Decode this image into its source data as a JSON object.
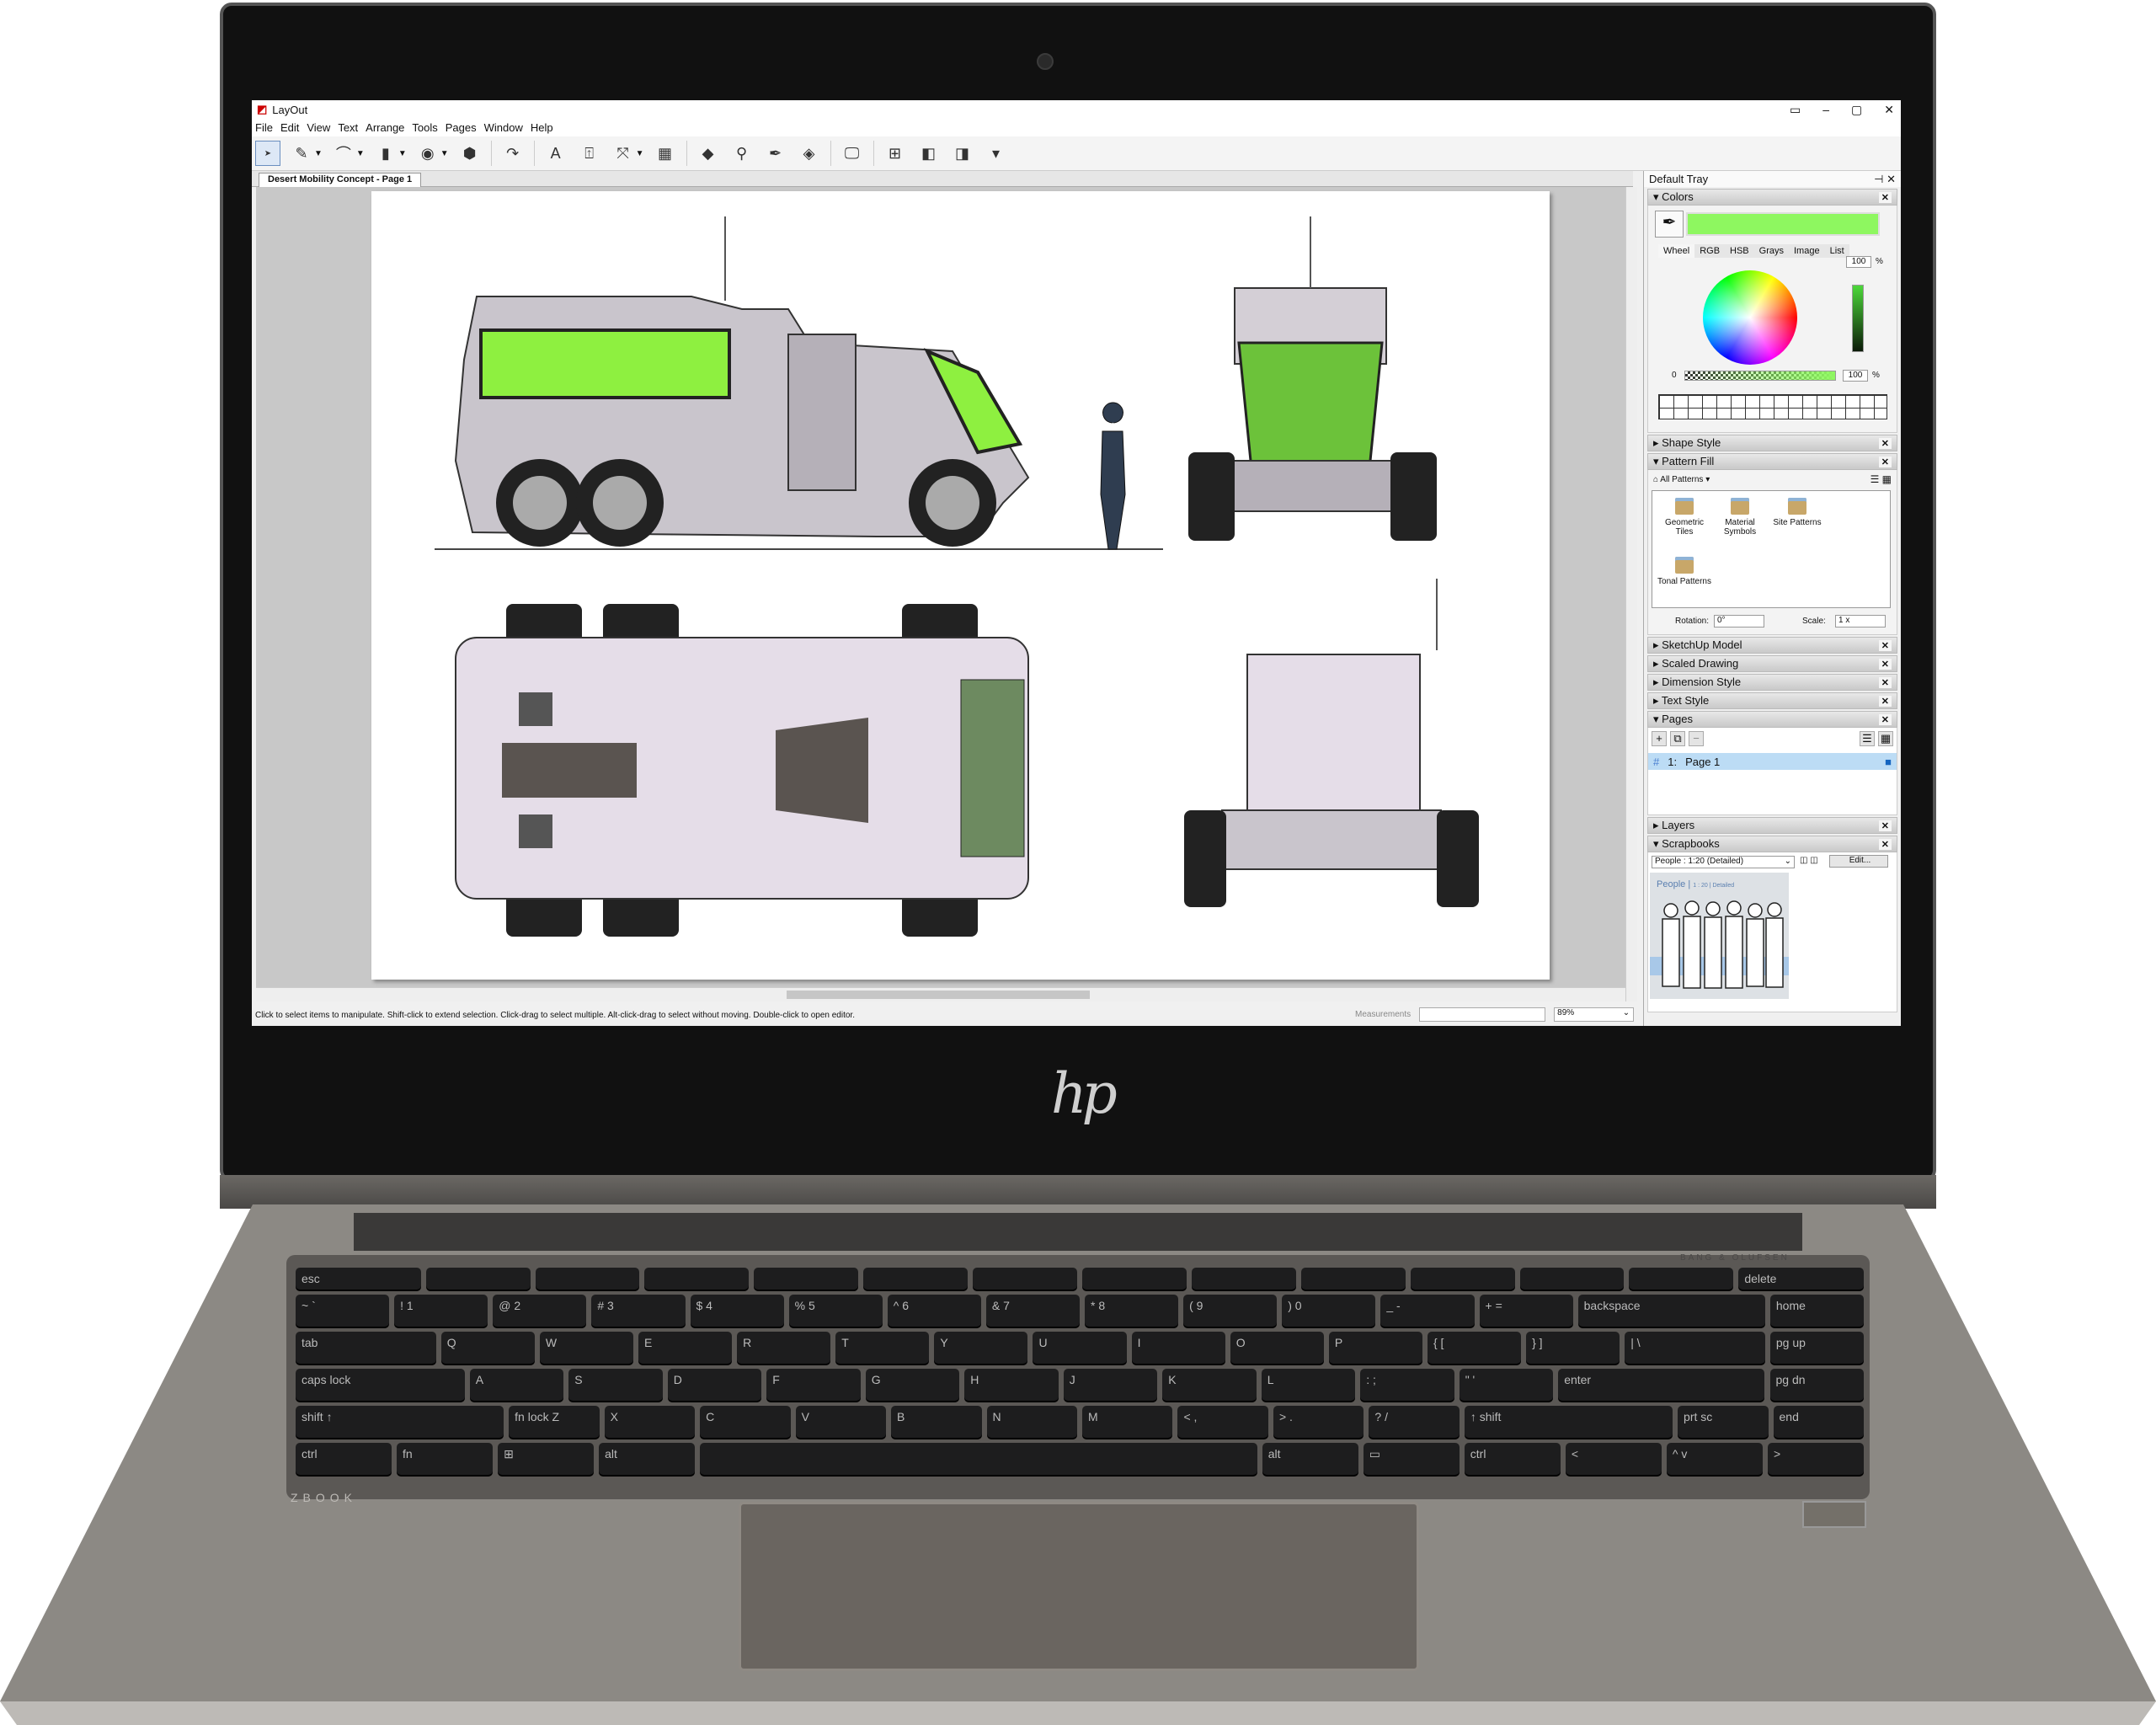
{
  "app": {
    "title": "LayOut",
    "window_controls": [
      "▭",
      "–",
      "▢",
      "✕"
    ]
  },
  "menu": [
    "File",
    "Edit",
    "View",
    "Text",
    "Arrange",
    "Tools",
    "Pages",
    "Window",
    "Help"
  ],
  "toolbar": [
    {
      "icon": "select-arrow-icon",
      "glyph": "➤",
      "selected": true
    },
    {
      "icon": "pencil-icon",
      "glyph": "✎",
      "dropdown": true
    },
    {
      "icon": "arc-icon",
      "glyph": "⌒",
      "dropdown": true
    },
    {
      "icon": "rectangle-icon",
      "glyph": "▮",
      "dropdown": true
    },
    {
      "icon": "circle-icon",
      "glyph": "◉",
      "dropdown": true
    },
    {
      "icon": "polygon-icon",
      "glyph": "⬢"
    },
    {
      "sep": true
    },
    {
      "icon": "offset-icon",
      "glyph": "↷"
    },
    {
      "sep": true
    },
    {
      "icon": "text-icon",
      "glyph": "A"
    },
    {
      "icon": "label-icon",
      "glyph": "⍐"
    },
    {
      "icon": "dimension-icon",
      "glyph": "⤧",
      "dropdown": true
    },
    {
      "icon": "table-icon",
      "glyph": "▦"
    },
    {
      "sep": true
    },
    {
      "icon": "eraser-icon",
      "glyph": "◆"
    },
    {
      "icon": "sample-style-icon",
      "glyph": "⚲"
    },
    {
      "icon": "split-icon",
      "glyph": "✒"
    },
    {
      "icon": "join-icon",
      "glyph": "◈"
    },
    {
      "sep": true
    },
    {
      "icon": "presentation-icon",
      "glyph": "🖵"
    },
    {
      "sep": true
    },
    {
      "icon": "add-page-icon",
      "glyph": "⊞"
    },
    {
      "icon": "previous-page-icon",
      "glyph": "◧"
    },
    {
      "icon": "next-page-icon",
      "glyph": "◨"
    },
    {
      "icon": "toolbar-overflow-icon",
      "glyph": "▾"
    }
  ],
  "document_tab": "Desert Mobility Concept - Page 1",
  "status": {
    "hint": "Click to select items to manipulate. Shift-click to extend selection. Click-drag to select multiple. Alt-click-drag to select without moving. Double-click to open editor.",
    "measurements_label": "Measurements",
    "measurements_value": "",
    "zoom": "89%"
  },
  "tray": {
    "title": "Default Tray",
    "colors": {
      "title": "Colors",
      "current_color": "#8ef760",
      "tabs": [
        "Wheel",
        "RGB",
        "HSB",
        "Grays",
        "Image",
        "List"
      ],
      "brightness": "100",
      "opacity_min": "0",
      "opacity": "100",
      "unit": "%"
    },
    "shape_style": "Shape Style",
    "pattern_fill": {
      "title": "Pattern Fill",
      "collection": "All Patterns",
      "folders": [
        "Geometric Tiles",
        "Material Symbols",
        "Site Patterns",
        "Tonal Patterns"
      ],
      "rotation_label": "Rotation:",
      "rotation": "0°",
      "scale_label": "Scale:",
      "scale": "1 x"
    },
    "collapsed": [
      "SketchUp Model",
      "Scaled Drawing",
      "Dimension Style",
      "Text Style"
    ],
    "pages": {
      "title": "Pages",
      "items": [
        {
          "number": "1:",
          "name": "Page 1"
        }
      ]
    },
    "layers": "Layers",
    "scrapbooks": {
      "title": "Scrapbooks",
      "selected": "People : 1:20 (Detailed)",
      "edit": "Edit...",
      "preview_title": "People",
      "preview_sub": "1 : 20 | Detailed"
    }
  },
  "device": {
    "brand": "hp",
    "speaker": "BANG & OLUFSEN",
    "model": "ZBOOK"
  },
  "keyboard": [
    [
      "esc",
      "",
      "",
      "",
      "",
      "",
      "",
      "",
      "",
      "",
      "",
      "",
      "",
      "delete"
    ],
    [
      "~ `",
      "! 1",
      "@ 2",
      "# 3",
      "$ 4",
      "% 5",
      "^ 6",
      "& 7",
      "* 8",
      "( 9",
      ") 0",
      "_ -",
      "+ =",
      "backspace",
      "home"
    ],
    [
      "tab",
      "Q",
      "W",
      "E",
      "R",
      "T",
      "Y",
      "U",
      "I",
      "O",
      "P",
      "{ [",
      "} ]",
      "| \\",
      "pg up"
    ],
    [
      "caps lock",
      "A",
      "S",
      "D",
      "F",
      "G",
      "H",
      "J",
      "K",
      "L",
      ": ;",
      "\" '",
      "enter",
      "pg dn"
    ],
    [
      "shift ↑",
      "fn lock Z",
      "X",
      "C",
      "V",
      "B",
      "N",
      "M",
      "< ,",
      "> .",
      "? /",
      "↑ shift",
      "prt sc",
      "end"
    ],
    [
      "ctrl",
      "fn",
      "⊞",
      "alt",
      "",
      "alt",
      "▭",
      "ctrl",
      "<",
      "^ v",
      ">"
    ]
  ]
}
